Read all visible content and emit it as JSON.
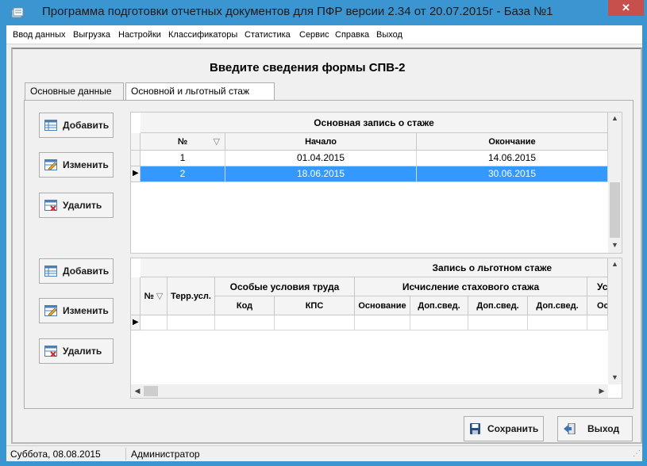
{
  "window": {
    "title": "Программа подготовки отчетных документов для ПФР версии 2.34 от 20.07.2015г - База №1",
    "close_label": "✕"
  },
  "menu": {
    "items": [
      "Ввод данных",
      "Выгрузка",
      "Настройки",
      "Классификаторы",
      "Статистика",
      "Сервис",
      "Справка",
      "Выход"
    ]
  },
  "form": {
    "title": "Введите сведения формы СПВ-2"
  },
  "tabs": [
    {
      "label": "Основные данные",
      "active": false
    },
    {
      "label": "Основной и льготный стаж",
      "active": true
    }
  ],
  "buttons": {
    "add": "Добавить",
    "edit": "Изменить",
    "delete": "Удалить",
    "save": "Сохранить",
    "exit": "Выход"
  },
  "main_grid": {
    "caption": "Основная запись о стаже",
    "columns": [
      "№",
      "Начало",
      "Окончание"
    ],
    "rows": [
      {
        "num": "1",
        "start": "01.04.2015",
        "end": "14.06.2015",
        "selected": false
      },
      {
        "num": "2",
        "start": "18.06.2015",
        "end": "30.06.2015",
        "selected": true
      }
    ]
  },
  "benefit_grid": {
    "caption": "Запись о льготном стаже",
    "columns": {
      "num": "№",
      "terr": "Терр.усл.",
      "special_group": "Особые условия труда",
      "code": "Код",
      "kps": "КПС",
      "calc_group": "Исчисление стахового стажа",
      "basis": "Основание",
      "extra1": "Доп.свед.",
      "extra2": "Доп.свед.",
      "extra3": "Доп.свед.",
      "cut_group": "Ус",
      "cut_sub": "Ос"
    }
  },
  "status": {
    "date": "Суббота, 08.08.2015",
    "user": "Администратор"
  },
  "colors": {
    "titlebar": "#3b95d0",
    "selection": "#3399ff",
    "close": "#c7504c"
  }
}
